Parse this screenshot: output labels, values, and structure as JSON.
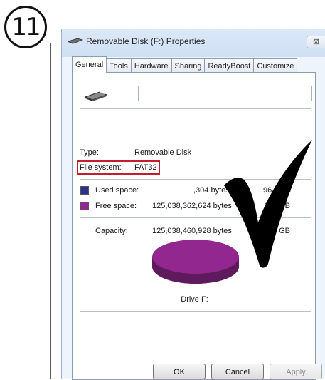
{
  "step_number": "11",
  "window": {
    "title": "Removable Disk (F:) Properties",
    "close_label": "⊠"
  },
  "tabs": [
    {
      "label": "General",
      "active": true
    },
    {
      "label": "Tools"
    },
    {
      "label": "Hardware"
    },
    {
      "label": "Sharing"
    },
    {
      "label": "ReadyBoost"
    },
    {
      "label": "Customize"
    }
  ],
  "general": {
    "name_value": "",
    "type_label": "Type:",
    "type_value": "Removable Disk",
    "fs_label": "File system:",
    "fs_value": "FAT32",
    "used_label": "Used space:",
    "used_bytes": ",304 bytes",
    "used_size": "96.0 KB",
    "free_label": "Free space:",
    "free_bytes": "125,038,362,624 bytes",
    "free_size": "116 GB",
    "capacity_label": "Capacity:",
    "capacity_bytes": "125,038,460,928 bytes",
    "capacity_size": "116 GB",
    "drive_label": "Drive F:"
  },
  "colors": {
    "used": "#2e3192",
    "free": "#92278f",
    "highlight": "#c41d2c"
  },
  "buttons": {
    "ok": "OK",
    "cancel": "Cancel",
    "apply": "Apply"
  }
}
